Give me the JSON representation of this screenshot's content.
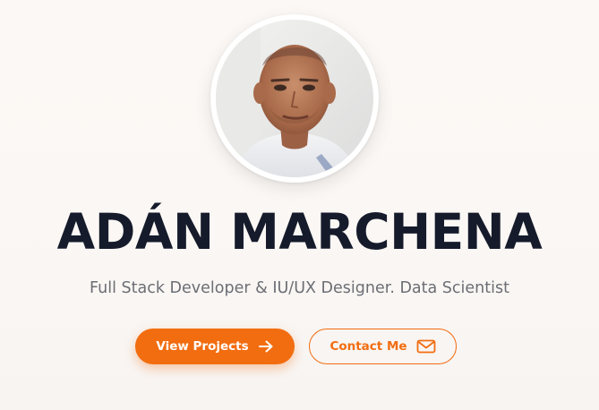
{
  "profile": {
    "name": "ADÁN MARCHENA",
    "subtitle": "Full Stack Developer & IU/UX Designer. Data Scientist"
  },
  "actions": {
    "primary_label": "View Projects",
    "primary_icon": "arrow-right-icon",
    "secondary_label": "Contact Me",
    "secondary_icon": "mail-icon"
  },
  "colors": {
    "accent": "#f26d10",
    "heading": "#151b2b",
    "subtitle": "#6b6e74",
    "background": "#fbf7f4"
  }
}
